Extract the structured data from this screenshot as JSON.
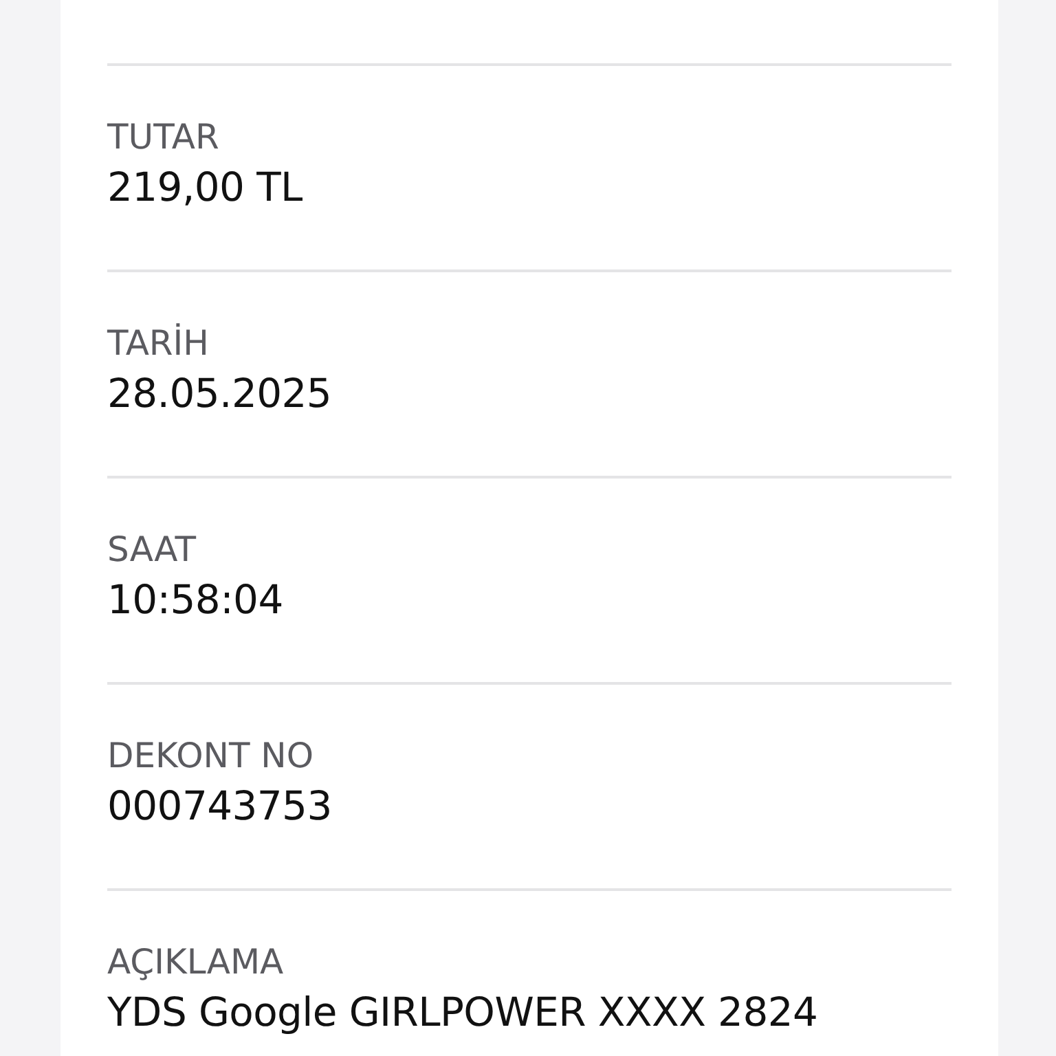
{
  "fields": [
    {
      "label": "TUTAR",
      "value": "219,00 TL"
    },
    {
      "label": "TARİH",
      "value": "28.05.2025"
    },
    {
      "label": "SAAT",
      "value": "10:58:04"
    },
    {
      "label": "DEKONT NO",
      "value": "000743753"
    },
    {
      "label": "AÇIKLAMA",
      "value": "YDS Google GIRLPOWER XXXX 2824"
    }
  ]
}
